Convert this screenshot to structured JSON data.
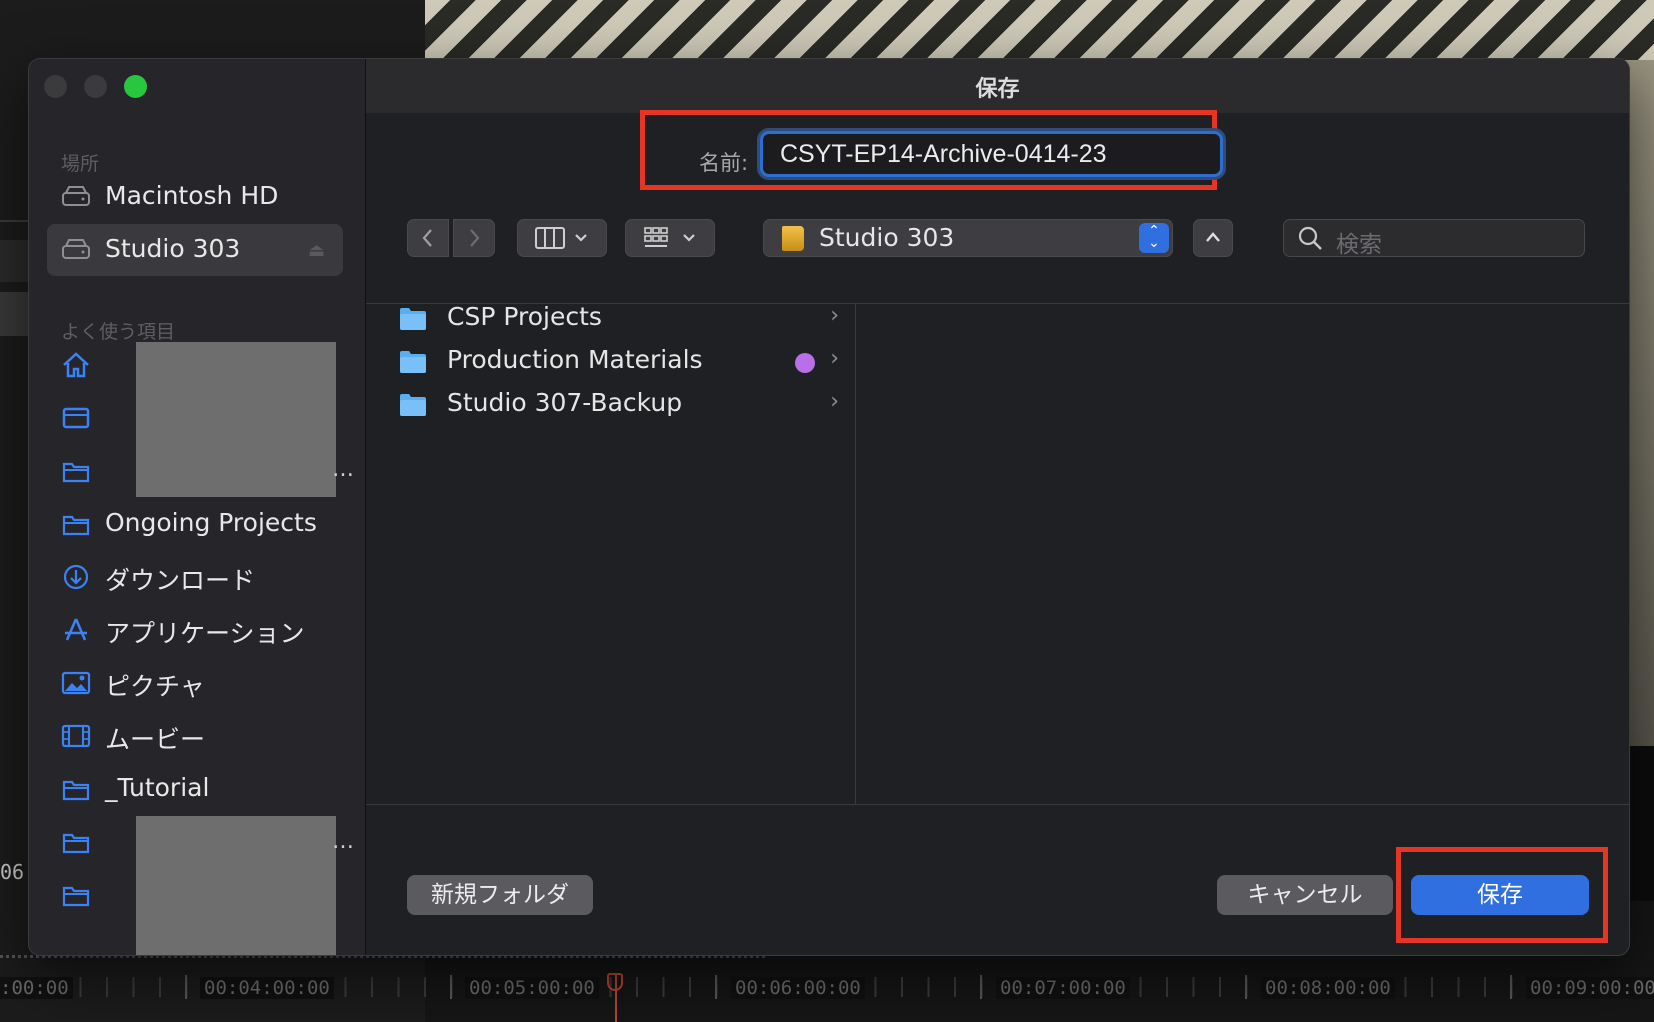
{
  "dialog": {
    "title": "保存",
    "name_label": "名前:",
    "name_value": "CSYT-EP14-Archive-0414-23",
    "location": "Studio 303",
    "search_placeholder": "検索",
    "new_folder_button": "新規フォルダ",
    "cancel_button": "キャンセル",
    "save_button": "保存"
  },
  "sidebar": {
    "section_locations": "場所",
    "locations": [
      {
        "label": "Macintosh HD",
        "icon": "disk-icon"
      },
      {
        "label": "Studio 303",
        "icon": "disk-icon",
        "selected": true
      }
    ],
    "section_favorites": "よく使う項目",
    "favorites": [
      {
        "label": "",
        "icon": "home-icon"
      },
      {
        "label": "",
        "icon": "desktop-icon"
      },
      {
        "label": "",
        "icon": "folder-icon"
      },
      {
        "label": "Ongoing Projects",
        "icon": "folder-icon"
      },
      {
        "label": "ダウンロード",
        "icon": "download-icon"
      },
      {
        "label": "アプリケーション",
        "icon": "applications-icon"
      },
      {
        "label": "ピクチャ",
        "icon": "photo-icon"
      },
      {
        "label": "ムービー",
        "icon": "film-icon"
      },
      {
        "label": "_Tutorial",
        "icon": "folder-icon"
      },
      {
        "label": "",
        "icon": "folder-icon"
      },
      {
        "label": "",
        "icon": "folder-icon"
      }
    ]
  },
  "files": [
    {
      "name": "CSP Projects",
      "tag": null
    },
    {
      "name": "Production Materials",
      "tag": "purple"
    },
    {
      "name": "Studio 307-Backup",
      "tag": null
    }
  ],
  "background": {
    "timecode_partial": "06:",
    "timeline_labels": [
      ":00:00",
      "00:04:00:00",
      "00:05:00:00",
      "00:06:00:00",
      "00:07:00:00",
      "00:08:00:00",
      "00:09:00:00"
    ]
  },
  "colors": {
    "accent": "#2f6fe0",
    "highlight_box": "#e53524",
    "tag_purple": "#b96fe8"
  }
}
